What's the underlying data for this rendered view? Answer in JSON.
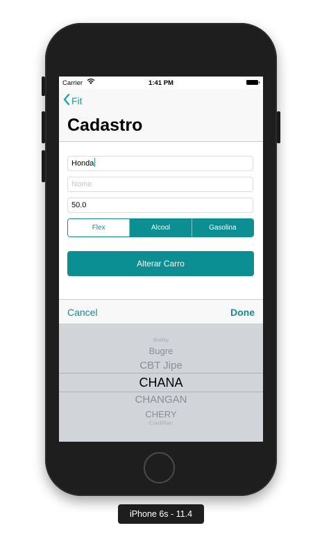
{
  "status_bar": {
    "carrier": "Carrier",
    "time": "1:41 PM"
  },
  "nav": {
    "back_label": "Fit",
    "title": "Cadastro"
  },
  "form": {
    "brand_value": "Honda",
    "name_placeholder": "Nome",
    "price_value": "50.0",
    "fuel_segments": [
      "Flex",
      "Alcool",
      "Gasolina"
    ],
    "selected_segment": "Flex",
    "submit_label": "Alterar Carro"
  },
  "toolbar": {
    "cancel_label": "Cancel",
    "done_label": "Done"
  },
  "picker": {
    "items": [
      "Baby",
      "Bugre",
      "CBT Jipe",
      "CHANA",
      "CHANGAN",
      "CHERY",
      "Cadillac"
    ],
    "selected": "CHANA"
  },
  "device_label": "iPhone 6s - 11.4",
  "colors": {
    "accent": "#0c8f92",
    "link": "#11a0a8",
    "picker_bg": "#d1d4d9",
    "device_frame": "#1e1e1e"
  }
}
